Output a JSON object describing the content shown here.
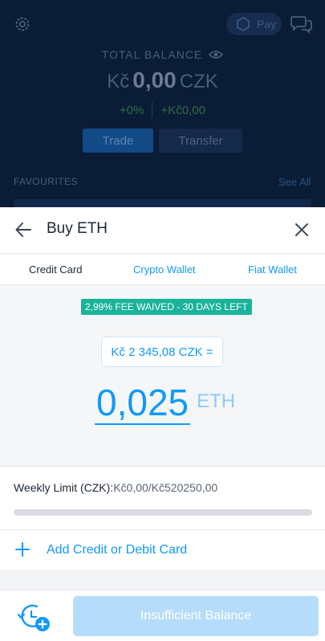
{
  "background": {
    "pay_label": "Pay",
    "total_balance_label": "TOTAL BALANCE",
    "balance_currency_prefix": "Kč",
    "balance_value": "0,00",
    "balance_currency_suffix": "CZK",
    "change_percent": "+0%",
    "change_amount": "+Kč0,00",
    "trade_label": "Trade",
    "transfer_label": "Transfer",
    "favourites_label": "FAVOURITES",
    "see_all_label": "See All"
  },
  "sheet": {
    "title": "Buy ETH",
    "tabs": [
      {
        "label": "Credit Card",
        "active": true
      },
      {
        "label": "Crypto Wallet",
        "active": false
      },
      {
        "label": "Fiat Wallet",
        "active": false
      }
    ],
    "fee_badge": "2,99% FEE WAIVED - 30 DAYS LEFT",
    "fiat_amount": "Kč 2 345,08 CZK =",
    "crypto_amount": "0,025",
    "crypto_currency": "ETH",
    "weekly_limit_label": "Weekly Limit (CZK):",
    "weekly_limit_value": "Kč0,00/Kč520250,00",
    "weekly_limit_used_fraction": 0,
    "add_card_label": "Add Credit or Debit Card",
    "cta_label": "Insufficient Balance"
  },
  "colors": {
    "accent": "#1199fa",
    "badge": "#1ab39a",
    "cta_disabled": "#b5dcfb",
    "background_dark": "#0b1c37"
  },
  "icons": [
    "gear-icon",
    "pay-logo-icon",
    "chat-icon",
    "eye-icon",
    "back-arrow-icon",
    "close-icon",
    "plus-icon",
    "schedule-add-icon"
  ]
}
